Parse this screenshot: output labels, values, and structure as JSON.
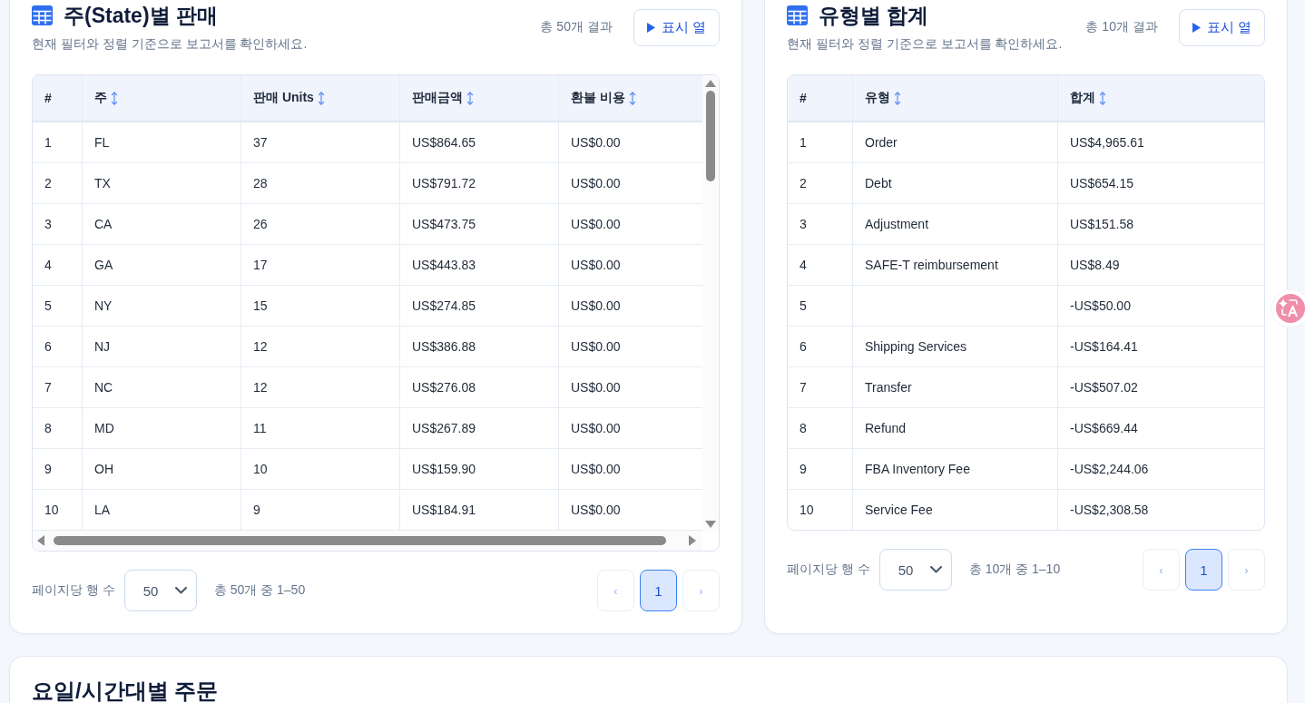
{
  "sections": [
    {
      "title": "주(State)별 판매",
      "subtitle": "현재 필터와 정렬 기준으로 보고서를 확인하세요.",
      "result_count": "총 50개 결과",
      "columns_button": "표시 열",
      "table": {
        "scrollable": true,
        "columns": [
          {
            "label": "#",
            "sortable": false
          },
          {
            "label": "주",
            "sortable": true
          },
          {
            "label": "판매 Units",
            "sortable": true
          },
          {
            "label": "판매금액",
            "sortable": true
          },
          {
            "label": "환불 비용",
            "sortable": true
          }
        ],
        "rows": [
          [
            "1",
            "FL",
            "37",
            "US$864.65",
            "US$0.00"
          ],
          [
            "2",
            "TX",
            "28",
            "US$791.72",
            "US$0.00"
          ],
          [
            "3",
            "CA",
            "26",
            "US$473.75",
            "US$0.00"
          ],
          [
            "4",
            "GA",
            "17",
            "US$443.83",
            "US$0.00"
          ],
          [
            "5",
            "NY",
            "15",
            "US$274.85",
            "US$0.00"
          ],
          [
            "6",
            "NJ",
            "12",
            "US$386.88",
            "US$0.00"
          ],
          [
            "7",
            "NC",
            "12",
            "US$276.08",
            "US$0.00"
          ],
          [
            "8",
            "MD",
            "11",
            "US$267.89",
            "US$0.00"
          ],
          [
            "9",
            "OH",
            "10",
            "US$159.90",
            "US$0.00"
          ],
          [
            "10",
            "LA",
            "9",
            "US$184.91",
            "US$0.00"
          ]
        ]
      },
      "pagination": {
        "rows_per_page_label": "페이지당 행 수",
        "rows_per_page": "50",
        "range": "총 50개 중 1–50",
        "prev": {
          "label": "‹",
          "disabled": true
        },
        "pages": [
          {
            "label": "1",
            "selected": true
          }
        ],
        "next": {
          "label": "›",
          "disabled": true
        }
      }
    },
    {
      "title": "유형별 합계",
      "subtitle": "현재 필터와 정렬 기준으로 보고서를 확인하세요.",
      "result_count": "총 10개 결과",
      "columns_button": "표시 열",
      "table": {
        "scrollable": false,
        "columns": [
          {
            "label": "#",
            "sortable": false
          },
          {
            "label": "유형",
            "sortable": true
          },
          {
            "label": "합계",
            "sortable": true
          }
        ],
        "rows": [
          [
            "1",
            "Order",
            "US$4,965.61"
          ],
          [
            "2",
            "Debt",
            "US$654.15"
          ],
          [
            "3",
            "Adjustment",
            "US$151.58"
          ],
          [
            "4",
            "SAFE-T reimbursement",
            "US$8.49"
          ],
          [
            "5",
            null,
            "-US$50.00"
          ],
          [
            "6",
            "Shipping Services",
            "-US$164.41"
          ],
          [
            "7",
            "Transfer",
            "-US$507.02"
          ],
          [
            "8",
            "Refund",
            "-US$669.44"
          ],
          [
            "9",
            "FBA Inventory Fee",
            "-US$2,244.06"
          ],
          [
            "10",
            "Service Fee",
            "-US$2,308.58"
          ]
        ]
      },
      "pagination": {
        "rows_per_page_label": "페이지당 행 수",
        "rows_per_page": "50",
        "range": "총 10개 중 1–10",
        "prev": {
          "label": "‹",
          "disabled": true
        },
        "pages": [
          {
            "label": "1",
            "selected": true
          }
        ],
        "next": {
          "label": "›",
          "disabled": true
        }
      }
    }
  ],
  "bottom_card": {
    "title": "요일/시간대별 주문"
  }
}
